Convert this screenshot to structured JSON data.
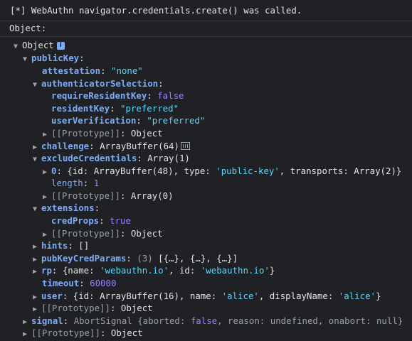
{
  "log": {
    "message": "[*] WebAuthn navigator.credentials.create() was called.",
    "object_label": "Object:"
  },
  "tree": {
    "root_label": "Object",
    "publicKey": "publicKey",
    "attestation_key": "attestation",
    "attestation_val": "\"none\"",
    "authSel_key": "authenticatorSelection",
    "requireResidentKey_key": "requireResidentKey",
    "requireResidentKey_val": "false",
    "residentKey_key": "residentKey",
    "residentKey_val": "\"preferred\"",
    "userVerification_key": "userVerification",
    "userVerification_val": "\"preferred\"",
    "proto_label": "[[Prototype]]",
    "proto_object": "Object",
    "challenge_key": "challenge",
    "challenge_val": "ArrayBuffer(64)",
    "exclude_key": "excludeCredentials",
    "exclude_val": "Array(1)",
    "item0_key": "0",
    "item0_open": "{id: ArrayBuffer(48), type: ",
    "item0_type": "'public-key'",
    "item0_mid": ", transports: Array(2)}",
    "length_key": "length",
    "length_val": "1",
    "proto_array0": "Array(0)",
    "extensions_key": "extensions",
    "credProps_key": "credProps",
    "credProps_val": "true",
    "hints_key": "hints",
    "hints_val": "[]",
    "pubKeyCred_key": "pubKeyCredParams",
    "pubKeyCred_count": "(3)",
    "pubKeyCred_val": "[{…}, {…}, {…}]",
    "rp_key": "rp",
    "rp_open": "{name: ",
    "rp_name": "'webauthn.io'",
    "rp_mid": ", id: ",
    "rp_id": "'webauthn.io'",
    "rp_close": "}",
    "timeout_key": "timeout",
    "timeout_val": "60000",
    "user_key": "user",
    "user_open": "{id: ArrayBuffer(16), name: ",
    "user_name": "'alice'",
    "user_mid": ", displayName: ",
    "user_display": "'alice'",
    "user_close": "}",
    "signal_key": "signal",
    "signal_open": "AbortSignal {aborted: ",
    "signal_aborted": "false",
    "signal_mid": ", reason: ",
    "signal_reason": "undefined",
    "signal_mid2": ", onabort: ",
    "signal_onabort": "null",
    "signal_close": "}"
  }
}
